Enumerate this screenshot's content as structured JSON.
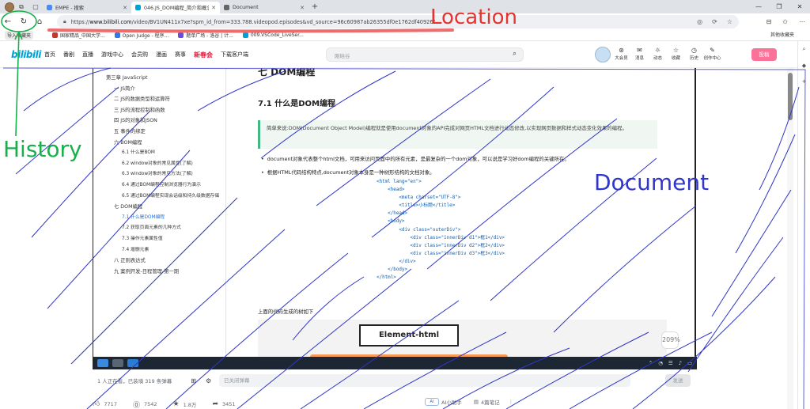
{
  "tabs": [
    {
      "label": "EMPE - 搜索",
      "active": false,
      "color": "#4a8cf7"
    },
    {
      "label": "046.JS_DOM编程_简介和概念引入",
      "active": true,
      "color": "#00a1d6"
    },
    {
      "label": "Document",
      "active": false,
      "color": "#666666"
    }
  ],
  "address": {
    "url_prefix": "https://",
    "url_host": "www.bilibili.com",
    "url_rest": "/video/BV1UN411x7xe?spm_id_from=333.788.videopod.episodes&vd_source=96c60987ab26355df0e1762df409266b&p=46"
  },
  "bookmarks": {
    "import_label": "导入收藏夹",
    "items": [
      {
        "label": "国家精品_中国大学...",
        "color": "#c0392b"
      },
      {
        "label": "Open Judge - 程序...",
        "color": "#2c7be5"
      },
      {
        "label": "题单广场 - 洛谷 | 计...",
        "color": "#6b4bd8"
      },
      {
        "label": "009.VSCode_LiveSer...",
        "color": "#00a1d6"
      }
    ],
    "other_label": "其他收藏夹"
  },
  "bili": {
    "logo": "bilibili",
    "nav": [
      "首页",
      "番剧",
      "直播",
      "游戏中心",
      "会员购",
      "漫画",
      "赛事"
    ],
    "spring": "新春会",
    "download": "下载客户端",
    "search_placeholder": "刚硅谷",
    "right_items": [
      {
        "label": "大会员",
        "glyph": "⊛"
      },
      {
        "label": "消息",
        "glyph": "✉"
      },
      {
        "label": "动态",
        "glyph": "☼"
      },
      {
        "label": "收藏",
        "glyph": "☆"
      },
      {
        "label": "历史",
        "glyph": "◷"
      },
      {
        "label": "创作中心",
        "glyph": "✎"
      }
    ],
    "upload": "投稿"
  },
  "doc": {
    "toc": [
      {
        "text": "第三章 JavaScript",
        "level": "l1"
      },
      {
        "text": "一 JS简介",
        "level": "l2b"
      },
      {
        "text": "二 JS的数据类型和运算符",
        "level": "l2b"
      },
      {
        "text": "三 JS的流程控制和函数",
        "level": "l2b"
      },
      {
        "text": "四 JS的对象和JSON",
        "level": "l2b"
      },
      {
        "text": "五 事件的绑定",
        "level": "l2b"
      },
      {
        "text": "六 BOM编程",
        "level": "l2b"
      },
      {
        "text": "6.1 什么是BOM",
        "level": "l2"
      },
      {
        "text": "6.2 window对象的常见属性(了解)",
        "level": "l2"
      },
      {
        "text": "6.3 window对象的常见方法(了解)",
        "level": "l2"
      },
      {
        "text": "6.4 通过BOM编程控制浏览器行为演示",
        "level": "l2"
      },
      {
        "text": "6.5 通过BOM编程实现会话级和持久级数据存储",
        "level": "l2"
      },
      {
        "text": "七 DOM编程",
        "level": "l2b"
      },
      {
        "text": "7.1 什么是DOM编程",
        "level": "l2",
        "active": true
      },
      {
        "text": "7.2 获取页面元素的几种方式",
        "level": "l2"
      },
      {
        "text": "7.3 操作元素属性值",
        "level": "l2"
      },
      {
        "text": "7.4 增删元素",
        "level": "l2"
      },
      {
        "text": "八 正则表达式",
        "level": "l2b"
      },
      {
        "text": "九 案例开发-日程管理-第一期",
        "level": "l2b"
      }
    ],
    "chapter_title": "七 DOM编程",
    "section_title": "7.1 什么是DOM编程",
    "tip": "简单来说:DOM(Document Object Model)编程就是使用document对象的API完成对网页HTML文档进行动态修改,以实现网页数据和样式动态变化效果的编程。",
    "bullet1": "document对象代表整个html文档，可用来访问页面中的所有元素，是最复杂的一个dom对象，可以说是学习好dom编程的关键所在。",
    "bullet2": "根据HTML代码结构特点,document对象本身是一种树形结构的文档对象。",
    "code_lines": [
      "<html lang=\"en\">",
      "    <head>",
      "        <meta charset=\"UTF-8\">",
      "        <title>小标题</title>",
      "    </head>",
      "    <body>",
      "        <div class=\"outerDiv\">",
      "            <div class=\"innerDiv d1\">框1</div>",
      "            <div class=\"innerDiv d2\">框2</div>",
      "            <div class=\"innerDiv d3\">框3</div>",
      "        </div>",
      "    </body>",
      "</html>"
    ],
    "below_text": "上面的代码生成的树如下",
    "element_box": "Element-html",
    "status_left": "<  </>",
    "float_label": "209%"
  },
  "danmaku": {
    "count": "1 人正在看，已装填 319 条弹幕",
    "placeholder": "已关闭弹幕",
    "send": "发送"
  },
  "actions": {
    "like": "7717",
    "coin": "7542",
    "fav": "1.8万",
    "share": "3451",
    "ai": "AI小助手",
    "notes": "4篇笔记"
  },
  "annotations": {
    "location": "Location",
    "history": "History",
    "document": "Document"
  }
}
